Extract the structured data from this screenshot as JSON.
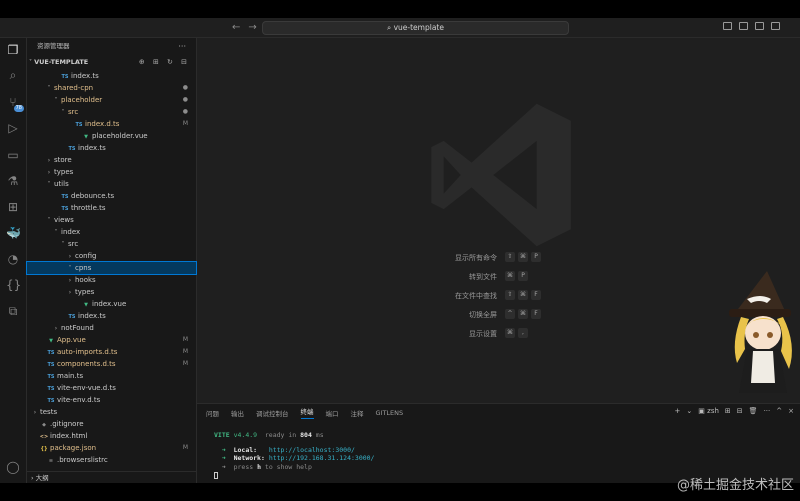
{
  "titlebar": {
    "back": "←",
    "forward": "→",
    "search_text": "⌕ vue-template"
  },
  "sidebar": {
    "header": "资源管理器",
    "more": "···",
    "section_title": "VUE-TEMPLATE",
    "section_actions": "⊕ ⊞ ↻ ⊟",
    "rows": [
      {
        "indent": 3,
        "chev": "",
        "icon": "TS",
        "icon_class": "c-ts",
        "label": "index.ts",
        "dec": "",
        "label_class": ""
      },
      {
        "indent": 2,
        "chev": "˅",
        "icon": "",
        "icon_class": "",
        "label": "shared-cpn",
        "dec": "●",
        "label_class": "c-mod"
      },
      {
        "indent": 3,
        "chev": "˅",
        "icon": "",
        "icon_class": "",
        "label": "placeholder",
        "dec": "●",
        "label_class": "c-mod"
      },
      {
        "indent": 4,
        "chev": "˅",
        "icon": "",
        "icon_class": "",
        "label": "src",
        "dec": "●",
        "label_class": "c-mod"
      },
      {
        "indent": 5,
        "chev": "",
        "icon": "TS",
        "icon_class": "c-ts",
        "label": "index.d.ts",
        "dec": "M",
        "label_class": "c-mod"
      },
      {
        "indent": 6,
        "chev": "",
        "icon": "▼",
        "icon_class": "c-vue",
        "label": "placeholder.vue",
        "dec": "",
        "label_class": ""
      },
      {
        "indent": 4,
        "chev": "",
        "icon": "TS",
        "icon_class": "c-ts",
        "label": "index.ts",
        "dec": "",
        "label_class": ""
      },
      {
        "indent": 2,
        "chev": "›",
        "icon": "",
        "icon_class": "",
        "label": "store",
        "dec": "",
        "label_class": ""
      },
      {
        "indent": 2,
        "chev": "›",
        "icon": "",
        "icon_class": "",
        "label": "types",
        "dec": "",
        "label_class": ""
      },
      {
        "indent": 2,
        "chev": "˅",
        "icon": "",
        "icon_class": "",
        "label": "utils",
        "dec": "",
        "label_class": ""
      },
      {
        "indent": 3,
        "chev": "",
        "icon": "TS",
        "icon_class": "c-ts",
        "label": "debounce.ts",
        "dec": "",
        "label_class": ""
      },
      {
        "indent": 3,
        "chev": "",
        "icon": "TS",
        "icon_class": "c-ts",
        "label": "throttle.ts",
        "dec": "",
        "label_class": ""
      },
      {
        "indent": 2,
        "chev": "˅",
        "icon": "",
        "icon_class": "",
        "label": "views",
        "dec": "",
        "label_class": ""
      },
      {
        "indent": 3,
        "chev": "˅",
        "icon": "",
        "icon_class": "",
        "label": "index",
        "dec": "",
        "label_class": ""
      },
      {
        "indent": 4,
        "chev": "˅",
        "icon": "",
        "icon_class": "",
        "label": "src",
        "dec": "",
        "label_class": ""
      },
      {
        "indent": 5,
        "chev": "›",
        "icon": "",
        "icon_class": "",
        "label": "config",
        "dec": "",
        "label_class": ""
      },
      {
        "indent": 5,
        "chev": "˅",
        "icon": "",
        "icon_class": "",
        "label": "cpns",
        "dec": "",
        "label_class": "",
        "selected": true
      },
      {
        "indent": 5,
        "chev": "›",
        "icon": "",
        "icon_class": "",
        "label": "hooks",
        "dec": "",
        "label_class": ""
      },
      {
        "indent": 5,
        "chev": "›",
        "icon": "",
        "icon_class": "",
        "label": "types",
        "dec": "",
        "label_class": ""
      },
      {
        "indent": 6,
        "chev": "",
        "icon": "▼",
        "icon_class": "c-vue",
        "label": "index.vue",
        "dec": "",
        "label_class": ""
      },
      {
        "indent": 4,
        "chev": "",
        "icon": "TS",
        "icon_class": "c-ts",
        "label": "index.ts",
        "dec": "",
        "label_class": ""
      },
      {
        "indent": 3,
        "chev": "›",
        "icon": "",
        "icon_class": "",
        "label": "notFound",
        "dec": "",
        "label_class": ""
      },
      {
        "indent": 1,
        "chev": "",
        "icon": "▼",
        "icon_class": "c-vue",
        "label": "App.vue",
        "dec": "M",
        "label_class": "c-mod"
      },
      {
        "indent": 1,
        "chev": "",
        "icon": "TS",
        "icon_class": "c-ts",
        "label": "auto-imports.d.ts",
        "dec": "M",
        "label_class": "c-mod"
      },
      {
        "indent": 1,
        "chev": "",
        "icon": "TS",
        "icon_class": "c-ts",
        "label": "components.d.ts",
        "dec": "M",
        "label_class": "c-mod"
      },
      {
        "indent": 1,
        "chev": "",
        "icon": "TS",
        "icon_class": "c-ts",
        "label": "main.ts",
        "dec": "",
        "label_class": ""
      },
      {
        "indent": 1,
        "chev": "",
        "icon": "TS",
        "icon_class": "c-ts",
        "label": "vite-env-vue.d.ts",
        "dec": "",
        "label_class": ""
      },
      {
        "indent": 1,
        "chev": "",
        "icon": "TS",
        "icon_class": "c-ts",
        "label": "vite-env.d.ts",
        "dec": "",
        "label_class": ""
      },
      {
        "indent": 0,
        "chev": "›",
        "icon": "",
        "icon_class": "",
        "label": "tests",
        "dec": "",
        "label_class": ""
      },
      {
        "indent": 0,
        "chev": "",
        "icon": "◆",
        "icon_class": "c-git",
        "label": ".gitignore",
        "dec": "",
        "label_class": ""
      },
      {
        "indent": 0,
        "chev": "",
        "icon": "<>",
        "icon_class": "c-mod",
        "label": "index.html",
        "dec": "",
        "label_class": ""
      },
      {
        "indent": 0,
        "chev": "",
        "icon": "{}",
        "icon_class": "c-json",
        "label": "package.json",
        "dec": "M",
        "label_class": "c-mod"
      },
      {
        "indent": 1,
        "chev": "",
        "icon": "≡",
        "icon_class": "c-git",
        "label": ".browserslistrc",
        "dec": "",
        "label_class": ""
      }
    ],
    "footer": "› 大纲"
  },
  "editor": {
    "shortcuts": [
      {
        "label": "显示所有命令",
        "keys": [
          "⇧",
          "⌘",
          "P"
        ]
      },
      {
        "label": "转到文件",
        "keys": [
          "⌘",
          "P"
        ]
      },
      {
        "label": "在文件中查找",
        "keys": [
          "⇧",
          "⌘",
          "F"
        ]
      },
      {
        "label": "切换全屏",
        "keys": [
          "^",
          "⌘",
          "F"
        ]
      },
      {
        "label": "显示设置",
        "keys": [
          "⌘",
          ","
        ]
      }
    ]
  },
  "panel": {
    "tabs": [
      "问题",
      "输出",
      "调试控制台",
      "终端",
      "端口",
      "注释",
      "GITLENS"
    ],
    "active_tab": 3,
    "shell": "zsh",
    "actions": [
      "+",
      "⌄",
      "⊞",
      "⊟",
      "🗑",
      "···",
      "^",
      "×"
    ],
    "terminal": {
      "vite_name": "VITE",
      "vite_version": "v4.4.9",
      "ready_text": "ready in",
      "ready_ms": "804",
      "ms": "ms",
      "arrow": "➜",
      "local_label": "Local:",
      "local_url": "http://localhost:3000/",
      "network_label": "Network:",
      "network_url": "http://192.168.31.124:3000/",
      "help_pre": "press",
      "help_key": "h",
      "help_post": "to show help"
    }
  },
  "watermark": "@稀土掘金技术社区",
  "colors": {
    "accent": "#0078d4",
    "vue_green": "#41b883",
    "ts_blue": "#4a9fd8",
    "modified": "#e2c08d",
    "badge": "#4a8fd6"
  }
}
